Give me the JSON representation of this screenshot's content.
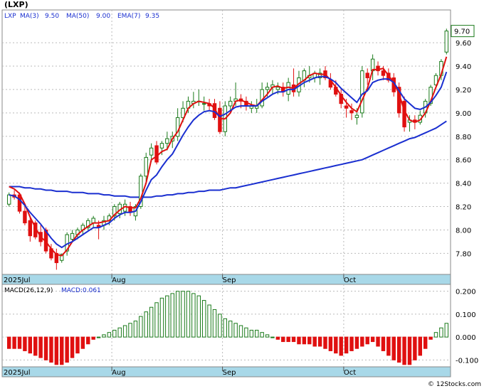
{
  "ticker_title": "(LXP)",
  "legend": {
    "symbol": "LXP",
    "items": [
      {
        "label": "MA(3)",
        "value": "9.50",
        "color": "#e01010"
      },
      {
        "label": "MA(50)",
        "value": "9.00",
        "color": "#1a2fd0"
      },
      {
        "label": "EMA(7)",
        "value": "9.35",
        "color": "#1a2fd0"
      }
    ]
  },
  "last_price_tag": "9.70",
  "month_labels": [
    {
      "label": "2025Jul",
      "index": 0
    },
    {
      "label": "Aug",
      "index": 20
    },
    {
      "label": "Sep",
      "index": 41
    },
    {
      "label": "Oct",
      "index": 64
    }
  ],
  "macd_legend": {
    "label": "MACD(26,12,9)",
    "value_label": "MACD:0.061"
  },
  "watermark": "© 12Stocks.com",
  "colors": {
    "up": "#1a7a1a",
    "up_fill": "#ffffff",
    "down": "#e01010",
    "ma3": "#e01010",
    "ema7": "#1a2fd0",
    "ma50": "#1a2fd0",
    "axis_band": "#a8d8e8",
    "macd_pos": "#1a7a1a",
    "macd_neg": "#e01010"
  },
  "chart_data": [
    {
      "type": "candlestick",
      "title": "(LXP)",
      "ylim": [
        7.62,
        9.88
      ],
      "yticks": [
        "7.80",
        "8.00",
        "8.20",
        "8.40",
        "8.60",
        "8.80",
        "9.00",
        "9.20",
        "9.40",
        "9.60"
      ],
      "grid": true,
      "series": [
        {
          "name": "LXP",
          "ohlc": [
            [
              8.22,
              8.32,
              8.2,
              8.3
            ],
            [
              8.3,
              8.34,
              8.26,
              8.28
            ],
            [
              8.3,
              8.32,
              8.14,
              8.16
            ],
            [
              8.16,
              8.2,
              8.04,
              8.06
            ],
            [
              8.08,
              8.12,
              7.9,
              7.95
            ],
            [
              8.06,
              8.08,
              7.92,
              7.94
            ],
            [
              7.98,
              8.04,
              7.86,
              7.9
            ],
            [
              8.0,
              8.02,
              7.8,
              7.82
            ],
            [
              7.84,
              7.88,
              7.74,
              7.76
            ],
            [
              7.8,
              7.84,
              7.66,
              7.72
            ],
            [
              7.74,
              7.8,
              7.72,
              7.79
            ],
            [
              7.82,
              7.98,
              7.78,
              7.96
            ],
            [
              7.92,
              8.0,
              7.9,
              7.97
            ],
            [
              7.96,
              8.02,
              7.92,
              8.0
            ],
            [
              8.0,
              8.06,
              7.96,
              8.04
            ],
            [
              8.02,
              8.1,
              8.0,
              8.08
            ],
            [
              8.06,
              8.12,
              8.02,
              8.1
            ],
            [
              8.04,
              8.08,
              7.92,
              8.02
            ],
            [
              8.04,
              8.12,
              8.0,
              8.08
            ],
            [
              8.08,
              8.14,
              8.04,
              8.12
            ],
            [
              8.12,
              8.22,
              8.08,
              8.2
            ],
            [
              8.14,
              8.24,
              8.1,
              8.22
            ],
            [
              8.16,
              8.26,
              8.12,
              8.22
            ],
            [
              8.2,
              8.24,
              8.12,
              8.15
            ],
            [
              8.12,
              8.22,
              8.08,
              8.2
            ],
            [
              8.2,
              8.48,
              8.18,
              8.46
            ],
            [
              8.46,
              8.66,
              8.4,
              8.62
            ],
            [
              8.64,
              8.74,
              8.58,
              8.7
            ],
            [
              8.72,
              8.76,
              8.56,
              8.58
            ],
            [
              8.7,
              8.76,
              8.64,
              8.74
            ],
            [
              8.74,
              8.84,
              8.68,
              8.78
            ],
            [
              8.76,
              8.84,
              8.7,
              8.8
            ],
            [
              8.8,
              9.04,
              8.76,
              8.96
            ],
            [
              8.96,
              9.1,
              8.92,
              9.04
            ],
            [
              9.04,
              9.14,
              9.0,
              9.1
            ],
            [
              9.08,
              9.18,
              9.04,
              9.1
            ],
            [
              9.1,
              9.2,
              9.06,
              9.1
            ],
            [
              9.08,
              9.14,
              9.02,
              9.08
            ],
            [
              9.08,
              9.12,
              9.02,
              9.06
            ],
            [
              9.08,
              9.12,
              8.94,
              8.96
            ],
            [
              9.04,
              9.1,
              8.82,
              8.84
            ],
            [
              8.84,
              9.1,
              8.8,
              9.06
            ],
            [
              9.06,
              9.14,
              9.0,
              9.1
            ],
            [
              9.1,
              9.26,
              9.06,
              9.12
            ],
            [
              9.12,
              9.16,
              9.04,
              9.1
            ],
            [
              9.1,
              9.14,
              9.02,
              9.06
            ],
            [
              9.04,
              9.1,
              9.0,
              9.06
            ],
            [
              9.04,
              9.12,
              9.0,
              9.06
            ],
            [
              9.06,
              9.26,
              9.04,
              9.2
            ],
            [
              9.2,
              9.26,
              9.14,
              9.22
            ],
            [
              9.22,
              9.28,
              9.16,
              9.24
            ],
            [
              9.2,
              9.26,
              9.16,
              9.22
            ],
            [
              9.22,
              9.26,
              9.14,
              9.18
            ],
            [
              9.16,
              9.3,
              9.1,
              9.26
            ],
            [
              9.24,
              9.38,
              9.14,
              9.18
            ],
            [
              9.18,
              9.36,
              9.14,
              9.3
            ],
            [
              9.28,
              9.38,
              9.22,
              9.36
            ],
            [
              9.3,
              9.4,
              9.26,
              9.32
            ],
            [
              9.3,
              9.36,
              9.26,
              9.34
            ],
            [
              9.3,
              9.38,
              9.24,
              9.34
            ],
            [
              9.36,
              9.4,
              9.28,
              9.3
            ],
            [
              9.28,
              9.34,
              9.2,
              9.22
            ],
            [
              9.22,
              9.28,
              9.14,
              9.16
            ],
            [
              9.16,
              9.2,
              9.04,
              9.08
            ],
            [
              9.06,
              9.12,
              8.96,
              9.04
            ],
            [
              9.02,
              9.08,
              8.94,
              9.0
            ],
            [
              8.96,
              9.04,
              8.9,
              8.98
            ],
            [
              9.0,
              9.4,
              8.96,
              9.36
            ],
            [
              9.34,
              9.38,
              9.24,
              9.3
            ],
            [
              9.36,
              9.5,
              9.28,
              9.46
            ],
            [
              9.4,
              9.44,
              9.32,
              9.36
            ],
            [
              9.36,
              9.4,
              9.28,
              9.32
            ],
            [
              9.34,
              9.38,
              9.26,
              9.28
            ],
            [
              9.3,
              9.34,
              9.14,
              9.18
            ],
            [
              9.22,
              9.26,
              8.96,
              9.0
            ],
            [
              9.1,
              9.14,
              8.84,
              8.88
            ],
            [
              8.92,
              8.98,
              8.84,
              8.94
            ],
            [
              8.94,
              8.98,
              8.86,
              8.92
            ],
            [
              8.92,
              9.02,
              8.9,
              8.98
            ],
            [
              9.0,
              9.12,
              8.96,
              9.1
            ],
            [
              9.08,
              9.24,
              9.06,
              9.22
            ],
            [
              9.24,
              9.34,
              9.22,
              9.32
            ],
            [
              9.32,
              9.46,
              9.28,
              9.44
            ],
            [
              9.52,
              9.72,
              9.5,
              9.7
            ]
          ]
        },
        {
          "name": "MA(3)",
          "values": [
            8.37,
            8.35,
            8.31,
            8.22,
            8.11,
            8.02,
            7.94,
            7.9,
            7.84,
            7.79,
            7.78,
            7.83,
            7.9,
            7.96,
            8.0,
            8.03,
            8.06,
            8.06,
            8.07,
            8.08,
            8.13,
            8.17,
            8.2,
            8.19,
            8.19,
            8.27,
            8.4,
            8.6,
            8.63,
            8.67,
            8.69,
            8.78,
            8.84,
            8.94,
            9.04,
            9.08,
            9.1,
            9.09,
            9.08,
            9.04,
            8.95,
            8.95,
            9.0,
            9.1,
            9.11,
            9.09,
            9.07,
            9.06,
            9.11,
            9.16,
            9.22,
            9.23,
            9.21,
            9.22,
            9.21,
            9.25,
            9.28,
            9.32,
            9.34,
            9.33,
            9.33,
            9.28,
            9.22,
            9.15,
            9.09,
            9.04,
            9.01,
            9.11,
            9.21,
            9.37,
            9.37,
            9.38,
            9.32,
            9.26,
            9.16,
            9.02,
            8.94,
            8.92,
            8.94,
            9.0,
            9.1,
            9.22,
            9.33,
            9.48
          ]
        },
        {
          "name": "EMA(7)",
          "values": [
            8.3,
            8.29,
            8.26,
            8.21,
            8.15,
            8.1,
            8.05,
            7.99,
            7.93,
            7.88,
            7.85,
            7.88,
            7.9,
            7.93,
            7.96,
            7.99,
            8.02,
            8.02,
            8.04,
            8.06,
            8.1,
            8.13,
            8.15,
            8.15,
            8.16,
            8.24,
            8.34,
            8.43,
            8.47,
            8.54,
            8.6,
            8.65,
            8.73,
            8.81,
            8.88,
            8.94,
            8.98,
            9.01,
            9.02,
            9.01,
            8.97,
            8.99,
            9.02,
            9.05,
            9.06,
            9.06,
            9.06,
            9.06,
            9.1,
            9.13,
            9.16,
            9.18,
            9.18,
            9.2,
            9.2,
            9.23,
            9.26,
            9.28,
            9.3,
            9.31,
            9.31,
            9.29,
            9.26,
            9.21,
            9.17,
            9.13,
            9.09,
            9.16,
            9.19,
            9.26,
            9.28,
            9.29,
            9.29,
            9.26,
            9.19,
            9.12,
            9.08,
            9.04,
            9.03,
            9.05,
            9.09,
            9.15,
            9.22,
            9.35
          ]
        },
        {
          "name": "MA(50)",
          "values": [
            8.37,
            8.37,
            8.37,
            8.36,
            8.36,
            8.35,
            8.35,
            8.34,
            8.34,
            8.33,
            8.33,
            8.33,
            8.32,
            8.32,
            8.32,
            8.31,
            8.31,
            8.31,
            8.3,
            8.3,
            8.29,
            8.29,
            8.29,
            8.28,
            8.28,
            8.28,
            8.28,
            8.28,
            8.29,
            8.29,
            8.3,
            8.3,
            8.31,
            8.31,
            8.32,
            8.32,
            8.33,
            8.33,
            8.34,
            8.34,
            8.34,
            8.35,
            8.36,
            8.36,
            8.37,
            8.38,
            8.39,
            8.4,
            8.41,
            8.42,
            8.43,
            8.44,
            8.45,
            8.46,
            8.47,
            8.48,
            8.49,
            8.5,
            8.51,
            8.52,
            8.53,
            8.54,
            8.55,
            8.56,
            8.57,
            8.58,
            8.59,
            8.6,
            8.62,
            8.64,
            8.66,
            8.68,
            8.7,
            8.72,
            8.74,
            8.76,
            8.78,
            8.79,
            8.81,
            8.83,
            8.85,
            8.87,
            8.9,
            8.93
          ]
        }
      ]
    },
    {
      "type": "bar",
      "title": "MACD(26,12,9)",
      "ylim": [
        -0.13,
        0.23
      ],
      "yticks": [
        "0.200",
        "0.100",
        "0.000",
        "-0.100"
      ],
      "grid": true,
      "series": [
        {
          "name": "MACD",
          "values": [
            -0.05,
            -0.05,
            -0.05,
            -0.06,
            -0.07,
            -0.08,
            -0.09,
            -0.1,
            -0.11,
            -0.12,
            -0.12,
            -0.11,
            -0.09,
            -0.07,
            -0.05,
            -0.03,
            -0.01,
            0.0,
            0.01,
            0.02,
            0.03,
            0.04,
            0.05,
            0.06,
            0.07,
            0.09,
            0.11,
            0.13,
            0.15,
            0.17,
            0.18,
            0.19,
            0.2,
            0.2,
            0.2,
            0.19,
            0.18,
            0.16,
            0.14,
            0.12,
            0.1,
            0.08,
            0.07,
            0.06,
            0.05,
            0.04,
            0.03,
            0.03,
            0.02,
            0.01,
            0.0,
            -0.01,
            -0.02,
            -0.02,
            -0.02,
            -0.03,
            -0.03,
            -0.03,
            -0.04,
            -0.04,
            -0.05,
            -0.06,
            -0.07,
            -0.08,
            -0.07,
            -0.06,
            -0.05,
            -0.04,
            -0.03,
            -0.02,
            -0.04,
            -0.06,
            -0.08,
            -0.1,
            -0.11,
            -0.12,
            -0.12,
            -0.1,
            -0.08,
            -0.05,
            -0.01,
            0.02,
            0.04,
            0.06
          ]
        }
      ]
    }
  ]
}
